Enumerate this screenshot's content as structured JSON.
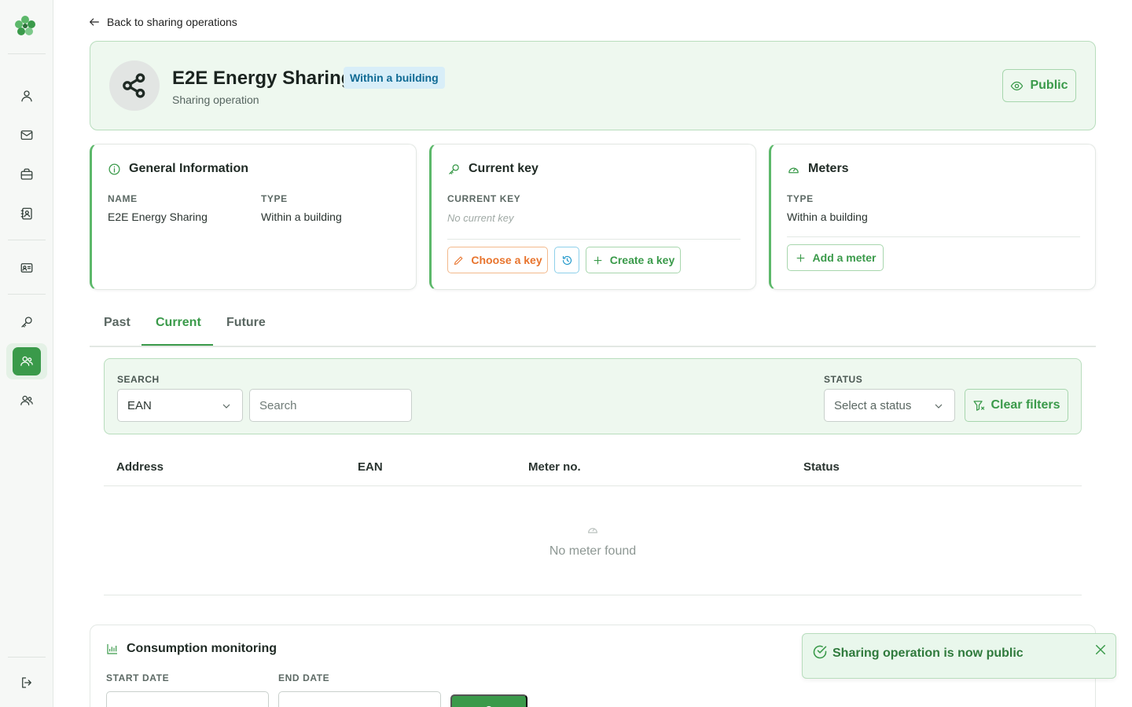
{
  "back_link": {
    "label": "Back to sharing operations",
    "icon": "arrow-left-icon"
  },
  "header": {
    "title": "E2E Energy Sharing",
    "badge": "Within a building",
    "subtitle": "Sharing operation",
    "public_button": "Public",
    "icon": "share-icon"
  },
  "general_info": {
    "title": "General Information",
    "name_label": "NAME",
    "name_value": "E2E Energy Sharing",
    "type_label": "TYPE",
    "type_value": "Within a building"
  },
  "current_key": {
    "title": "Current key",
    "label": "CURRENT KEY",
    "empty": "No current key",
    "choose_button": "Choose a key",
    "create_button": "Create a key"
  },
  "meters_card": {
    "title": "Meters",
    "type_label": "TYPE",
    "type_value": "Within a building",
    "add_button": "Add a meter"
  },
  "tabs": [
    {
      "label": "Past"
    },
    {
      "label": "Current",
      "active": true
    },
    {
      "label": "Future"
    }
  ],
  "filters": {
    "search_label": "SEARCH",
    "search_field_select": "EAN",
    "search_placeholder": "Search",
    "status_label": "STATUS",
    "status_placeholder": "Select a status",
    "clear_button": "Clear filters"
  },
  "table": {
    "columns": [
      "Address",
      "EAN",
      "Meter no.",
      "Status"
    ],
    "empty_text": "No meter found"
  },
  "consumption": {
    "title": "Consumption monitoring",
    "start_label": "START DATE",
    "end_label": "END DATE"
  },
  "toast": {
    "message": "Sharing operation is now public"
  },
  "colors": {
    "accent": "#3a9a4a",
    "accent_light": "#eef8ef",
    "badge_bg": "#d8eef8",
    "badge_text": "#0f6a94",
    "orange": "#e8742d",
    "blue": "#1995c9"
  }
}
